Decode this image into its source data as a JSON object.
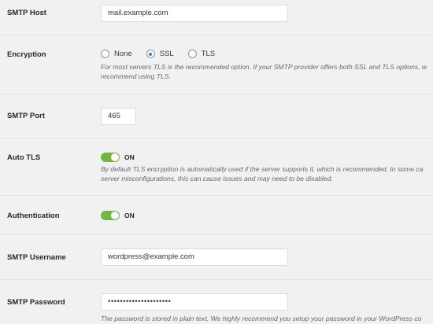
{
  "fields": {
    "smtp_host": {
      "label": "SMTP Host",
      "value": "mail.example.com"
    },
    "encryption": {
      "label": "Encryption",
      "options": [
        {
          "label": "None",
          "checked": false
        },
        {
          "label": "SSL",
          "checked": true
        },
        {
          "label": "TLS",
          "checked": false
        }
      ],
      "desc_line1": "For most servers TLS is the recommended option. If your SMTP provider offers both SSL and TLS options, w",
      "desc_line2": "recommend using TLS."
    },
    "smtp_port": {
      "label": "SMTP Port",
      "value": "465"
    },
    "auto_tls": {
      "label": "Auto TLS",
      "state": "ON",
      "desc_line1": "By default TLS encryption is automatically used if the server supports it, which is recommended. In some ca",
      "desc_line2": "server misconfigurations, this can cause issues and may need to be disabled."
    },
    "authentication": {
      "label": "Authentication",
      "state": "ON"
    },
    "smtp_username": {
      "label": "SMTP Username",
      "value": "wordpress@example.com"
    },
    "smtp_password": {
      "label": "SMTP Password",
      "value": "•••••••••••••••••••••",
      "desc_line1": "The password is stored in plain text. We highly recommend you setup your password in your WordPress co"
    }
  },
  "colors": {
    "toggle_on": "#73b53e",
    "radio_checked": "#3582c4",
    "background": "#f1f1f1"
  }
}
